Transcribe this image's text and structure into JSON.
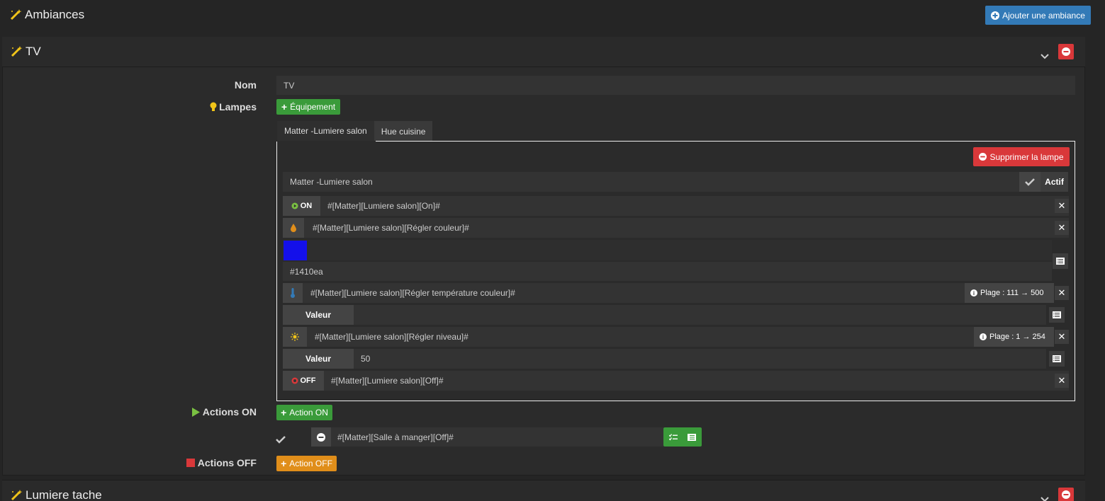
{
  "page": {
    "title": "Ambiances",
    "add_button": "Ajouter une ambiance"
  },
  "ambiance": {
    "title": "TV",
    "form": {
      "name_label": "Nom",
      "name_value": "TV",
      "lamps_label": "Lampes",
      "equipment_button": "Équipement"
    },
    "tabs": [
      {
        "label": "Matter -Lumiere salon",
        "active": true
      },
      {
        "label": "Hue cuisine",
        "active": false
      }
    ],
    "lamp": {
      "delete_button": "Supprimer la lampe",
      "name": "Matter -Lumiere salon",
      "actif_label": "Actif",
      "on_label": "ON",
      "on_command": "#[Matter][Lumiere salon][On]#",
      "color_command": "#[Matter][Lumiere salon][Régler couleur]#",
      "color_value": "#1410ea",
      "temp_command": "#[Matter][Lumiere salon][Régler température couleur]#",
      "temp_range": "Plage : 111 → 500",
      "temp_value_label": "Valeur",
      "temp_value": "",
      "level_command": "#[Matter][Lumiere salon][Régler niveau]#",
      "level_range": "Plage : 1 → 254",
      "level_value_label": "Valeur",
      "level_value": "50",
      "off_label": "OFF",
      "off_command": "#[Matter][Lumiere salon][Off]#"
    },
    "actions_on": {
      "label": "Actions ON",
      "button": "Action ON",
      "items": [
        {
          "command": "#[Matter][Salle à manger][Off]#"
        }
      ]
    },
    "actions_off": {
      "label": "Actions OFF",
      "button": "Action OFF"
    }
  },
  "ambiance2": {
    "title": "Lumiere tache"
  },
  "colors": {
    "accent_blue": "#337ab7",
    "green": "#3a9b3a",
    "red": "#d9383a",
    "orange": "#e08e1a",
    "swatch": "#1410ea"
  }
}
